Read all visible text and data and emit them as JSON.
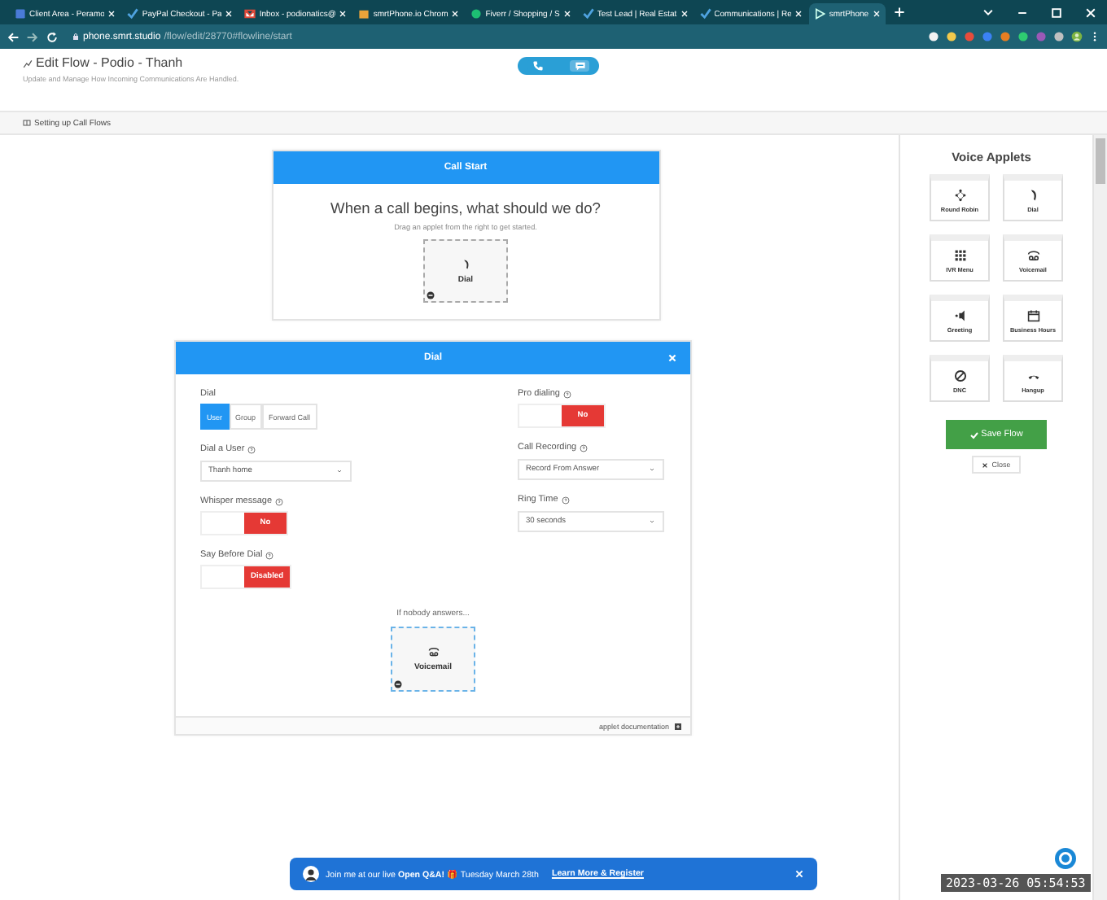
{
  "browser": {
    "tabs": [
      {
        "title": "Client Area - Peramo",
        "selected": false,
        "kind": "doc"
      },
      {
        "title": "PayPal Checkout - Pa",
        "selected": false,
        "kind": "check"
      },
      {
        "title": "Inbox - podionatics@",
        "selected": false,
        "kind": "mail"
      },
      {
        "title": "smrtPhone.io Chrom",
        "selected": false,
        "kind": "store"
      },
      {
        "title": "Fiverr / Shopping / S",
        "selected": false,
        "kind": "green"
      },
      {
        "title": "Test Lead | Real Estat",
        "selected": false,
        "kind": "check"
      },
      {
        "title": "Communications | Re",
        "selected": false,
        "kind": "check"
      },
      {
        "title": "smrtPhone",
        "selected": true,
        "kind": "play"
      }
    ],
    "address_host": "phone.smrt.studio",
    "address_path": "/flow/edit/28770#flowline/start"
  },
  "page": {
    "title": "Edit Flow - Podio - Thanh",
    "subtitle": "Update and Manage How Incoming Communications Are Handled.",
    "breadcrumb": "Setting up Call Flows",
    "mode_switch": [
      {
        "kind": "phone",
        "selected": true
      },
      {
        "kind": "sms",
        "selected": false
      }
    ]
  },
  "call_start": {
    "header": "Call Start",
    "question": "When a call begins, what should we do?",
    "hint": "Drag an applet from the right to get started.",
    "applet": {
      "label": "Dial",
      "kind": "dial"
    }
  },
  "dial_panel": {
    "header": "Dial",
    "dial_label": "Dial",
    "dial_options": [
      {
        "label": "User",
        "selected": true
      },
      {
        "label": "Group",
        "selected": false
      },
      {
        "label": "Forward Call",
        "selected": false
      }
    ],
    "left_fields": [
      {
        "label": "Dial a User",
        "kind": "select",
        "value": "Thanh home"
      },
      {
        "label": "Whisper message",
        "kind": "toggle",
        "value": "No",
        "on": false
      },
      {
        "label": "Say Before Dial",
        "kind": "toggle",
        "value": "Disabled",
        "on": false
      }
    ],
    "right_fields": [
      {
        "label": "Pro dialing",
        "kind": "toggle",
        "value": "No",
        "on": false
      },
      {
        "label": "Call Recording",
        "kind": "select",
        "value": "Record From Answer"
      },
      {
        "label": "Ring Time",
        "kind": "select",
        "value": "30 seconds"
      }
    ],
    "fallback_label": "If nobody answers...",
    "fallback_applet": {
      "label": "Voicemail",
      "kind": "voicemail"
    },
    "doc_link": "applet documentation"
  },
  "sidebar": {
    "title": "Voice Applets",
    "applets": [
      {
        "label": "Round Robin",
        "kind": "robin"
      },
      {
        "label": "Dial",
        "kind": "dial"
      },
      {
        "label": "IVR Menu",
        "kind": "ivr"
      },
      {
        "label": "Voicemail",
        "kind": "voicemail"
      },
      {
        "label": "Greeting",
        "kind": "greeting"
      },
      {
        "label": "Business Hours",
        "kind": "calendar"
      },
      {
        "label": "DNC",
        "kind": "dnc"
      },
      {
        "label": "Hangup",
        "kind": "hangup"
      }
    ],
    "save_button": "Save Flow",
    "close_button": "Close"
  },
  "banner": {
    "text": "Join me at our live **Open Q&A!** 🎁 Tuesday March 28th",
    "link": "Learn More & Register"
  },
  "timestamp": "2023-03-26 05:54:53"
}
